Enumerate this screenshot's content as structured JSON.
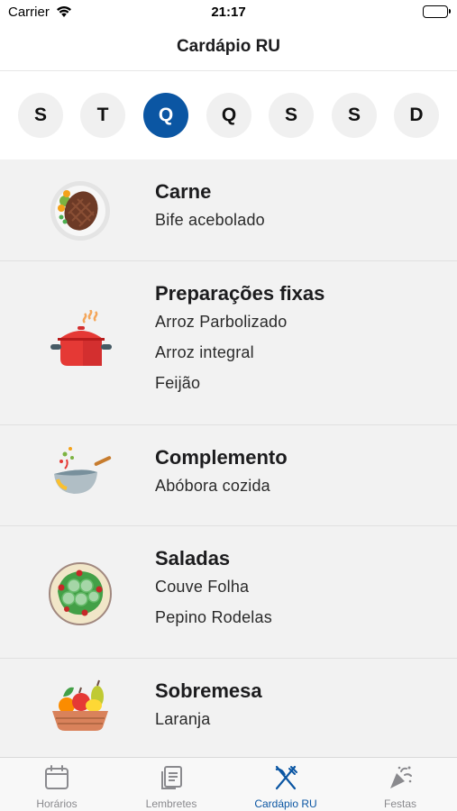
{
  "status_bar": {
    "carrier": "Carrier",
    "time": "21:17"
  },
  "nav": {
    "title": "Cardápio RU"
  },
  "days": [
    {
      "label": "S",
      "selected": false
    },
    {
      "label": "T",
      "selected": false
    },
    {
      "label": "Q",
      "selected": true
    },
    {
      "label": "Q",
      "selected": false
    },
    {
      "label": "S",
      "selected": false
    },
    {
      "label": "S",
      "selected": false
    },
    {
      "label": "D",
      "selected": false
    }
  ],
  "menu": [
    {
      "icon": "steak-icon",
      "title": "Carne",
      "dishes": [
        "Bife acebolado"
      ]
    },
    {
      "icon": "cooking-pot-icon",
      "title": "Preparações fixas",
      "dishes": [
        "Arroz Parbolizado",
        "Arroz integral",
        "Feijão"
      ]
    },
    {
      "icon": "wok-icon",
      "title": "Complemento",
      "dishes": [
        "Abóbora cozida"
      ]
    },
    {
      "icon": "salad-plate-icon",
      "title": "Saladas",
      "dishes": [
        "Couve Folha",
        "Pepino Rodelas"
      ]
    },
    {
      "icon": "fruit-basket-icon",
      "title": "Sobremesa",
      "dishes": [
        "Laranja"
      ]
    }
  ],
  "tabs": [
    {
      "label": "Horários",
      "icon": "calendar-icon",
      "active": false
    },
    {
      "label": "Lembretes",
      "icon": "notes-icon",
      "active": false
    },
    {
      "label": "Cardápio RU",
      "icon": "fork-knife-icon",
      "active": true
    },
    {
      "label": "Festas",
      "icon": "party-popper-icon",
      "active": false
    }
  ],
  "colors": {
    "accent": "#0b56a3",
    "list_background": "#f2f2f2",
    "inactive_tab": "#8a8a8e"
  }
}
